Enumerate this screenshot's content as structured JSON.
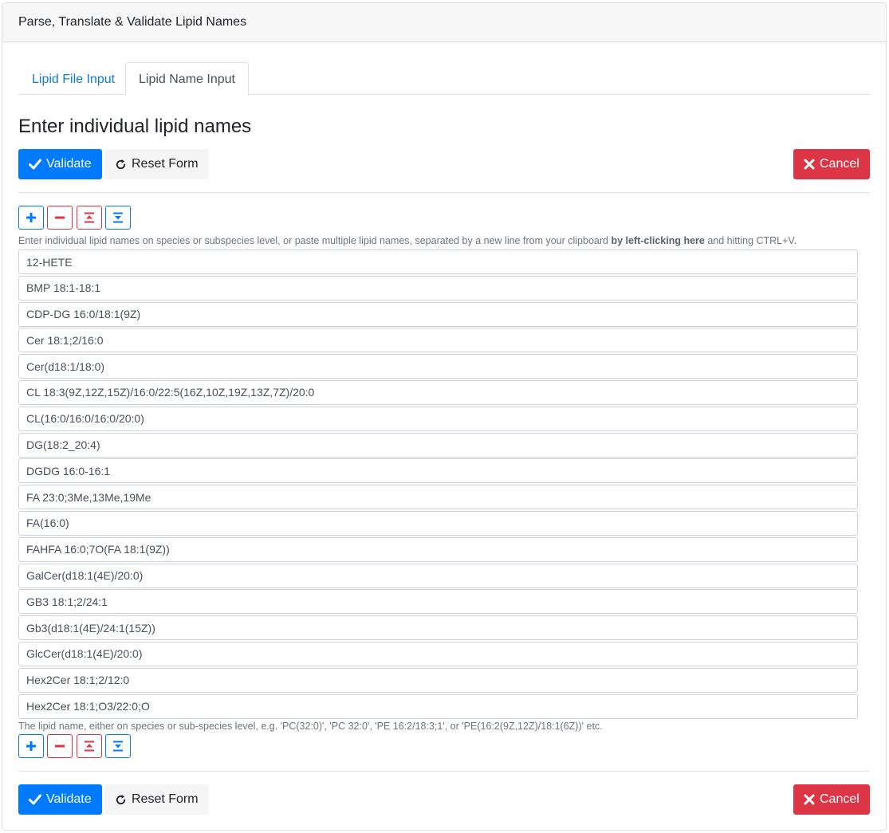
{
  "header": {
    "title": "Parse, Translate & Validate Lipid Names"
  },
  "tabs": [
    {
      "label": "Lipid File Input",
      "active": false
    },
    {
      "label": "Lipid Name Input",
      "active": true
    }
  ],
  "heading": "Enter individual lipid names",
  "actions": {
    "validate_label": "Validate",
    "reset_label": "Reset Form",
    "cancel_label": "Cancel"
  },
  "help": {
    "top_prefix": "Enter individual lipid names on species or subspecies level, or paste multiple lipid names, separated by a new line from your clipboard ",
    "top_bold": "by left-clicking here",
    "top_suffix": " and hitting CTRL+V.",
    "bottom": "The lipid name, either on species or sub-species level, e.g. 'PC(32:0)', 'PC 32:0', 'PE 16:2/18:3;1', or 'PE(16:2(9Z,12Z)/18:1(6Z))' etc."
  },
  "lipids": [
    "12-HETE",
    "BMP 18:1-18:1",
    "CDP-DG 16:0/18:1(9Z)",
    "Cer 18:1;2/16:0",
    "Cer(d18:1/18:0)",
    "CL 18:3(9Z,12Z,15Z)/16:0/22:5(16Z,10Z,19Z,13Z,7Z)/20:0",
    "CL(16:0/16:0/16:0/20:0)",
    "DG(18:2_20:4)",
    "DGDG 16:0-16:1",
    "FA 23:0;3Me,13Me,19Me",
    "FA(16:0)",
    "FAHFA 16:0;7O(FA 18:1(9Z))",
    "GalCer(d18:1(4E)/20:0)",
    "GB3 18:1;2/24:1",
    "Gb3(d18:1(4E)/24:1(15Z))",
    "GlcCer(d18:1(4E)/20:0)",
    "Hex2Cer 18:1;2/12:0",
    "Hex2Cer 18:1;O3/22:0;O"
  ],
  "colors": {
    "primary": "#007bff",
    "danger": "#dc3545",
    "link": "#0d7dd8"
  },
  "icons": [
    "check-icon",
    "reset-icon",
    "close-icon",
    "plus-icon",
    "minus-icon",
    "move-top-icon",
    "move-bottom-icon"
  ]
}
